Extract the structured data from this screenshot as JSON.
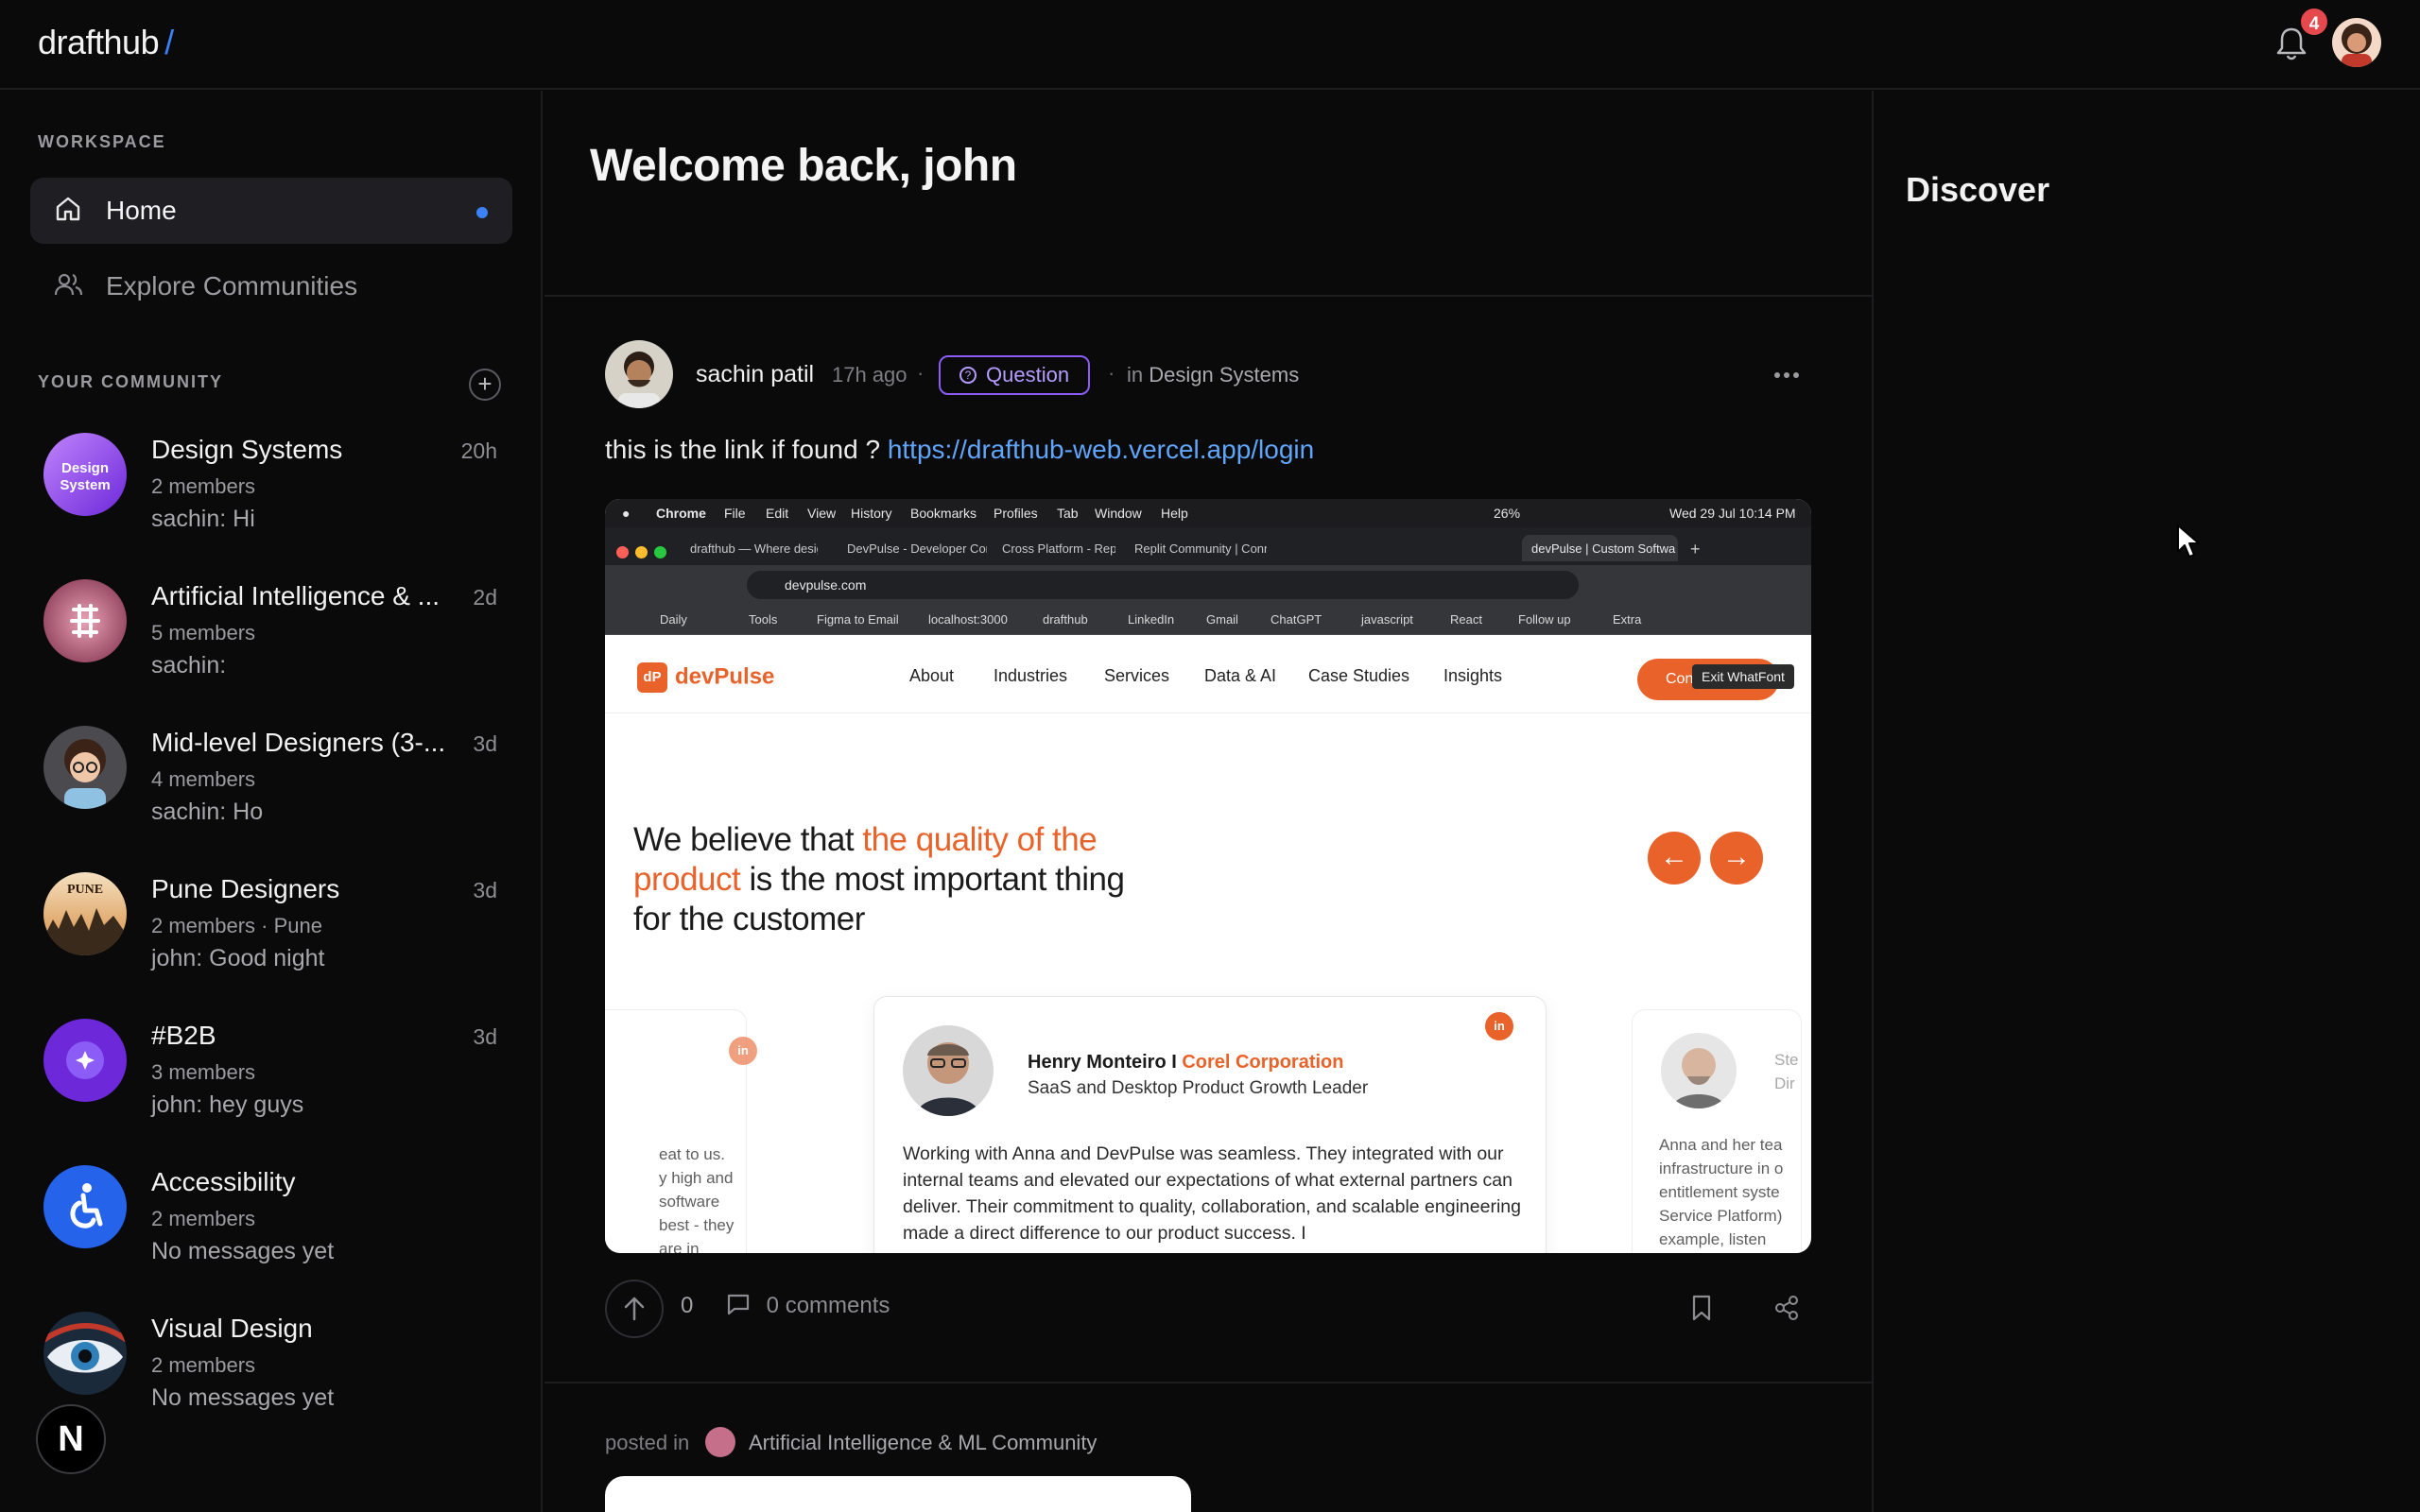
{
  "app": {
    "logo": "drafthub",
    "logo_slash": "/",
    "notifications": "4"
  },
  "sidebar": {
    "workspace_label": "WORKSPACE",
    "nav": [
      {
        "label": "Home"
      },
      {
        "label": "Explore Communities"
      }
    ],
    "community_label": "YOUR COMMUNITY",
    "add_symbol": "+",
    "communities": [
      {
        "name": "Design Systems",
        "time": "20h",
        "meta": "2 members",
        "msg": "sachin: Hi",
        "avatar_text": "Design System"
      },
      {
        "name": "Artificial Intelligence & ...",
        "time": "2d",
        "meta": "5 members",
        "msg": "sachin:"
      },
      {
        "name": "Mid-level Designers (3-...",
        "time": "3d",
        "meta": "4 members",
        "msg": "sachin: Ho"
      },
      {
        "name": "Pune Designers",
        "time": "3d",
        "meta": "2 members · Pune",
        "msg": "john: Good night",
        "avatar_text": "PUNE"
      },
      {
        "name": "#B2B",
        "time": "3d",
        "meta": "3 members",
        "msg": "john: hey guys"
      },
      {
        "name": "Accessibility",
        "time": "",
        "meta": "2 members",
        "msg": "No messages yet"
      },
      {
        "name": "Visual Design",
        "time": "",
        "meta": "2 members",
        "msg": "No messages yet"
      }
    ],
    "bottom_badge": "N"
  },
  "main": {
    "welcome": "Welcome back, john",
    "post": {
      "author": "sachin patil",
      "time": "17h ago",
      "sep": "·",
      "tag": "Question",
      "in_prefix": "in",
      "community": "Design Systems",
      "text": "this is the link if found ?",
      "link": "https://drafthub-web.vercel.app/login",
      "upvotes": "0",
      "comments": "0 comments"
    },
    "next_post": {
      "posted_in": "posted in",
      "community": "Artificial Intelligence & ML Community"
    }
  },
  "embedded": {
    "menubar": [
      "Chrome",
      "File",
      "Edit",
      "View",
      "History",
      "Bookmarks",
      "Profiles",
      "Tab",
      "Window",
      "Help"
    ],
    "battery": "26%",
    "datetime": "Wed 29 Jul  10:14 PM",
    "tabs": [
      "drafthub — Where designe",
      "DevPulse - Developer Com",
      "Cross Platform - Replit",
      "Replit Community | Conne",
      "devPulse | Custom Softwa"
    ],
    "new_tab": "+",
    "address": "devpulse.com",
    "bookmarks": [
      "Daily",
      "Tools",
      "Figma to Email",
      "localhost:3000",
      "drafthub",
      "LinkedIn",
      "Gmail",
      "ChatGPT",
      "javascript",
      "React",
      "Follow up",
      "Extra"
    ],
    "site_logo": "devPulse",
    "site_logo_mark": "dP",
    "site_nav": [
      "About",
      "Industries",
      "Services",
      "Data & AI",
      "Case Studies",
      "Insights"
    ],
    "contact": "Cont",
    "tooltip": "Exit WhatFont",
    "hero_1": "We believe that ",
    "hero_hl1": "the quality of the",
    "hero_hl2": "product",
    "hero_2": " is the most important thing",
    "hero_3": "for the customer",
    "prev_arrow": "←",
    "next_arrow": "→",
    "testimonial": {
      "name": "Henry Monteiro I ",
      "company": "Corel Corporation",
      "role": "SaaS and Desktop Product Growth Leader",
      "quote": "Working with Anna and DevPulse was seamless. They integrated with our internal teams and elevated our expectations of what external partners can deliver. Their commitment to quality, collaboration, and scalable engineering made a direct difference to our product success. I"
    },
    "in_badge": "in",
    "left_card_text": "eat to us.\ny high and\nsoftware\nbest - they are in",
    "right_card_title": "Ste\nDir",
    "right_card_text": "Anna and her tea\ninfrastructure in o\nentitlement syste\nService Platform)\nexample, listen"
  },
  "right": {
    "title": "Discover"
  }
}
